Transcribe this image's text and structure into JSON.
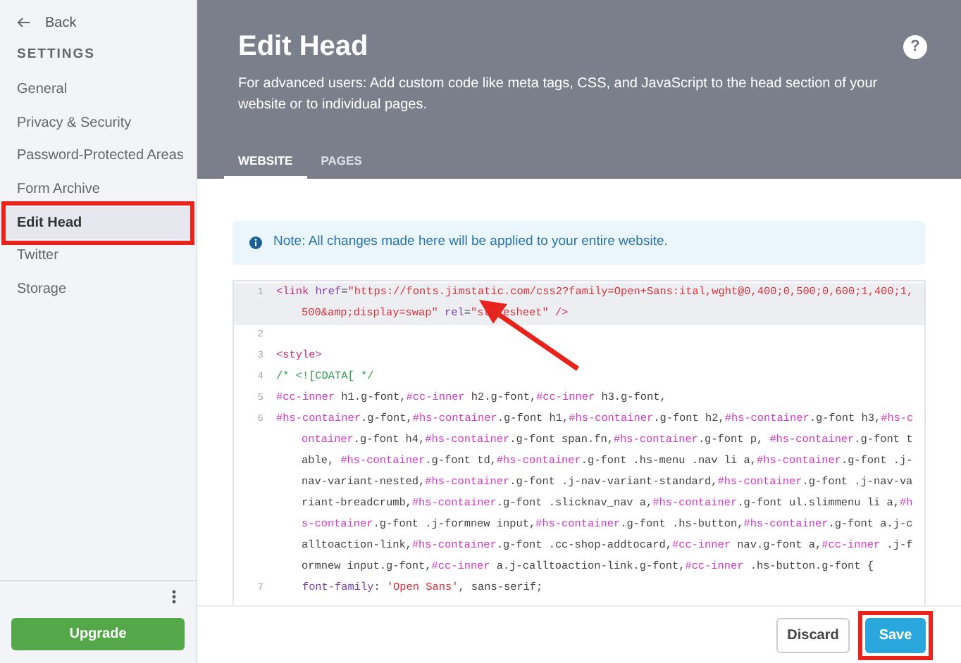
{
  "sidebar": {
    "back": {
      "label": "Back"
    },
    "section_title": "SETTINGS",
    "items": [
      {
        "label": "General",
        "selected": false
      },
      {
        "label": "Privacy & Security",
        "selected": false
      },
      {
        "label": "Password-Protected Areas",
        "selected": false
      },
      {
        "label": "Form Archive",
        "selected": false
      },
      {
        "label": "Edit Head",
        "selected": true
      },
      {
        "label": "Twitter",
        "selected": false
      },
      {
        "label": "Storage",
        "selected": false
      }
    ],
    "upgrade_button": "Upgrade"
  },
  "header": {
    "title": "Edit Head",
    "help_icon": "?",
    "description": "For advanced users: Add custom code like meta tags, CSS, and JavaScript to the head section of your website or to individual pages.",
    "tabs": [
      {
        "label": "WEBSITE",
        "selected": true
      },
      {
        "label": "PAGES",
        "selected": false
      }
    ]
  },
  "note": {
    "text": "Note: All changes made here will be applied to your entire website."
  },
  "editor": {
    "lines": [
      {
        "number": "1",
        "active": true,
        "tokens": [
          {
            "kind": "tag",
            "text": "<link "
          },
          {
            "kind": "attr",
            "text": "href"
          },
          {
            "kind": "plain",
            "text": "="
          },
          {
            "kind": "string",
            "text": "\"https://fonts.jimstatic.com/css2?family=Open+Sans:ital,wght@0,400;0,500;0,600;1,400;1,500&amp;display=swap\""
          },
          {
            "kind": "attr",
            "text": " rel"
          },
          {
            "kind": "plain",
            "text": "="
          },
          {
            "kind": "string",
            "text": "\"stylesheet\""
          },
          {
            "kind": "tag",
            "text": " />"
          }
        ]
      },
      {
        "number": "2",
        "active": false
      },
      {
        "number": "3",
        "active": false,
        "tokens": [
          {
            "kind": "tag",
            "text": "<style>"
          }
        ]
      },
      {
        "number": "4",
        "active": false,
        "tokens": [
          {
            "kind": "comment",
            "text": "/* <![CDATA[ */"
          }
        ]
      },
      {
        "number": "5",
        "active": false,
        "tokens": [
          {
            "kind": "selector",
            "text": "#cc-inner"
          },
          {
            "kind": "plain",
            "text": " h1.g-font,"
          },
          {
            "kind": "selector",
            "text": "#cc-inner"
          },
          {
            "kind": "plain",
            "text": " h2.g-font,"
          },
          {
            "kind": "selector",
            "text": "#cc-inner"
          },
          {
            "kind": "plain",
            "text": " h3.g-font,"
          }
        ]
      },
      {
        "number": "6",
        "active": false,
        "tokens": [
          {
            "kind": "selector",
            "text": "#hs-container"
          },
          {
            "kind": "plain",
            "text": ".g-font,"
          },
          {
            "kind": "selector",
            "text": "#hs-container"
          },
          {
            "kind": "plain",
            "text": ".g-font h1,"
          },
          {
            "kind": "selector",
            "text": "#hs-container"
          },
          {
            "kind": "plain",
            "text": ".g-font h2,"
          },
          {
            "kind": "selector",
            "text": "#hs-container"
          },
          {
            "kind": "plain",
            "text": ".g-font h3,"
          },
          {
            "kind": "selector",
            "text": "#hs-container"
          },
          {
            "kind": "plain",
            "text": ".g-font h4,"
          },
          {
            "kind": "selector",
            "text": "#hs-container"
          },
          {
            "kind": "plain",
            "text": ".g-font span.fn,"
          },
          {
            "kind": "selector",
            "text": "#hs-container"
          },
          {
            "kind": "plain",
            "text": ".g-font p, "
          },
          {
            "kind": "selector",
            "text": "#hs-container"
          },
          {
            "kind": "plain",
            "text": ".g-font table, "
          },
          {
            "kind": "selector",
            "text": "#hs-container"
          },
          {
            "kind": "plain",
            "text": ".g-font td,"
          },
          {
            "kind": "selector",
            "text": "#hs-container"
          },
          {
            "kind": "plain",
            "text": ".g-font .hs-menu .nav li a,"
          },
          {
            "kind": "selector",
            "text": "#hs-container"
          },
          {
            "kind": "plain",
            "text": ".g-font .j-nav-variant-nested,"
          },
          {
            "kind": "selector",
            "text": "#hs-container"
          },
          {
            "kind": "plain",
            "text": ".g-font .j-nav-variant-standard,"
          },
          {
            "kind": "selector",
            "text": "#hs-container"
          },
          {
            "kind": "plain",
            "text": ".g-font .j-nav-variant-breadcrumb,"
          },
          {
            "kind": "selector",
            "text": "#hs-container"
          },
          {
            "kind": "plain",
            "text": ".g-font .slicknav_nav a,"
          },
          {
            "kind": "selector",
            "text": "#hs-container"
          },
          {
            "kind": "plain",
            "text": ".g-font ul.slimmenu li a,"
          },
          {
            "kind": "selector",
            "text": "#hs-container"
          },
          {
            "kind": "plain",
            "text": ".g-font .j-formnew input,"
          },
          {
            "kind": "selector",
            "text": "#hs-container"
          },
          {
            "kind": "plain",
            "text": ".g-font .hs-button,"
          },
          {
            "kind": "selector",
            "text": "#hs-container"
          },
          {
            "kind": "plain",
            "text": ".g-font a.j-calltoaction-link,"
          },
          {
            "kind": "selector",
            "text": "#hs-container"
          },
          {
            "kind": "plain",
            "text": ".g-font .cc-shop-addtocard,"
          },
          {
            "kind": "selector",
            "text": "#cc-inner"
          },
          {
            "kind": "plain",
            "text": " nav.g-font a,"
          },
          {
            "kind": "selector",
            "text": "#cc-inner"
          },
          {
            "kind": "plain",
            "text": " .j-formnew input.g-font,"
          },
          {
            "kind": "selector",
            "text": "#cc-inner"
          },
          {
            "kind": "plain",
            "text": " a.j-calltoaction-link.g-font,"
          },
          {
            "kind": "selector",
            "text": "#cc-inner"
          },
          {
            "kind": "plain",
            "text": " .hs-button.g-font {"
          }
        ]
      },
      {
        "number": "7",
        "active": false,
        "tokens": [
          {
            "kind": "property",
            "text": "    font-family"
          },
          {
            "kind": "plain",
            "text": ": "
          },
          {
            "kind": "string",
            "text": "'Open Sans'"
          },
          {
            "kind": "plain",
            "text": ", sans-serif;"
          }
        ]
      }
    ]
  },
  "footer": {
    "buttons": [
      {
        "label": "Discard",
        "kind": "secondary"
      },
      {
        "label": "Save",
        "kind": "primary"
      }
    ]
  }
}
